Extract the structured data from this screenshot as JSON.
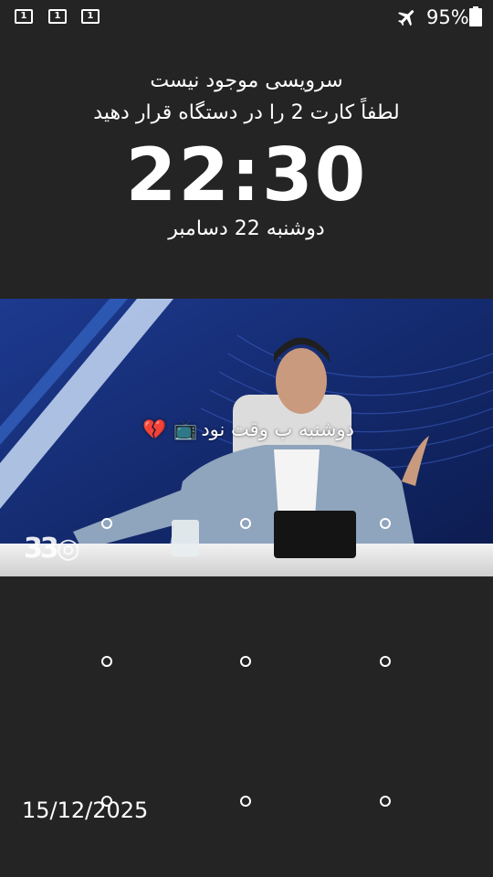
{
  "status_bar": {
    "sim_slots": [
      "1",
      "1",
      "1"
    ],
    "airplane_icon": "airplane-icon",
    "battery_percent": "95%",
    "battery_icon": "battery-icon"
  },
  "lock_screen": {
    "carrier_status": "سرویسی موجود نیست",
    "sim_prompt": "لطفاً کارت 2 را در دستگاه قرار دهید",
    "time": "22:30",
    "date": "دوشنبه 22 دسامبر"
  },
  "wallpaper": {
    "caption_text": "دوشنبه ب وقت نود",
    "caption_emojis": [
      "tv-icon",
      "broken-heart-icon"
    ],
    "channel_logo": "3",
    "background_color": "#1a2f7a"
  },
  "pattern_lock": {
    "rows": 3,
    "columns": 3
  },
  "footer": {
    "date_stamp": "15/12/2025"
  },
  "colors": {
    "background": "#252424",
    "text": "#ffffff"
  }
}
